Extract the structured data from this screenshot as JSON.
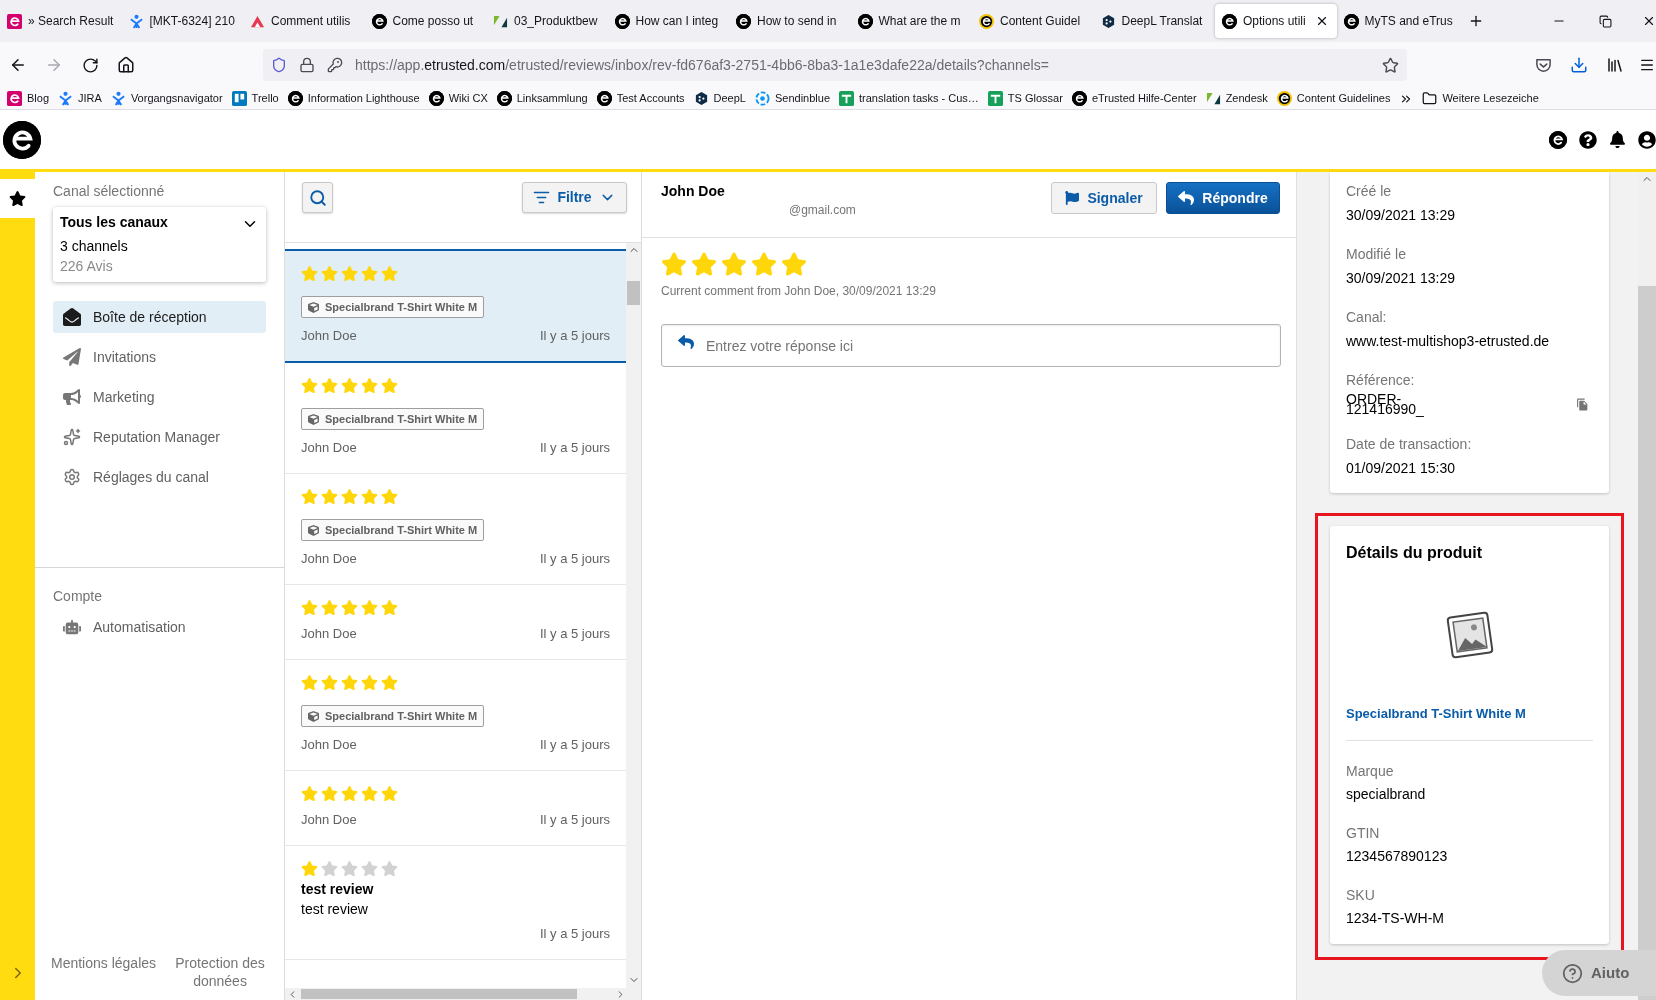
{
  "browser": {
    "tabs": [
      {
        "title": "» Search Result",
        "selected": false
      },
      {
        "title": "[MKT-6324] 210",
        "selected": false
      },
      {
        "title": "Comment utilis",
        "selected": false
      },
      {
        "title": "Come posso ut",
        "selected": false
      },
      {
        "title": "03_Produktbew",
        "selected": false
      },
      {
        "title": "How can I integ",
        "selected": false
      },
      {
        "title": "How to send in",
        "selected": false
      },
      {
        "title": "What are the m",
        "selected": false
      },
      {
        "title": "Content Guidel",
        "selected": false
      },
      {
        "title": "DeepL Translat",
        "selected": false
      },
      {
        "title": "Options utili",
        "selected": true
      },
      {
        "title": "MyTS and eTrus",
        "selected": false
      }
    ],
    "address": {
      "scheme": "https://app.",
      "domain": "etrusted.com",
      "path": "/etrusted/reviews/inbox/rev-fd676af3-2751-4bb6-8ba3-1a1e3dafe22a/details?channels="
    },
    "bookmarks": [
      "Blog",
      "JIRA",
      "Vorgangsnavigator",
      "Trello",
      "Information Lighthouse",
      "Wiki CX",
      "Linksammlung",
      "Test Accounts",
      "DeepL",
      "Sendinblue",
      "translation tasks - Cus…",
      "TS Glossar",
      "eTrusted Hilfe-Center",
      "Zendesk",
      "Content Guidelines"
    ],
    "other_bookmarks": "Weitere Lesezeiche"
  },
  "sidebar": {
    "channel_label": "Canal sélectionné",
    "channel_picker": {
      "title": "Tous les canaux",
      "subtitle": "3 channels",
      "count": "226 Avis"
    },
    "nav": [
      {
        "label": "Boîte de réception",
        "selected": true
      },
      {
        "label": "Invitations",
        "selected": false
      },
      {
        "label": "Marketing",
        "selected": false
      },
      {
        "label": "Reputation Manager",
        "selected": false
      },
      {
        "label": "Réglages du canal",
        "selected": false
      }
    ],
    "account_label": "Compte",
    "account_nav": [
      {
        "label": "Automatisation",
        "selected": false
      }
    ],
    "footer_links": [
      "Mentions légales",
      "Protection des données"
    ]
  },
  "reviews": {
    "filter_button": "Filtre",
    "items": [
      {
        "stars": 5,
        "product": "Specialbrand T-Shirt White M",
        "author": "John Doe",
        "time": "Il y a 5 jours",
        "selected": true
      },
      {
        "stars": 5,
        "product": "Specialbrand T-Shirt White M",
        "author": "John Doe",
        "time": "Il y a 5 jours",
        "selected": false
      },
      {
        "stars": 5,
        "product": "Specialbrand T-Shirt White M",
        "author": "John Doe",
        "time": "Il y a 5 jours",
        "selected": false
      },
      {
        "stars": 5,
        "author": "John Doe",
        "time": "Il y a 5 jours",
        "selected": false
      },
      {
        "stars": 5,
        "product": "Specialbrand T-Shirt White M",
        "author": "John Doe",
        "time": "Il y a 5 jours",
        "selected": false
      },
      {
        "stars": 5,
        "author": "John Doe",
        "time": "Il y a 5 jours",
        "selected": false
      },
      {
        "stars": 1,
        "title": "test review",
        "text": "test review",
        "time": "Il y a 5 jours",
        "selected": false
      }
    ]
  },
  "detail": {
    "author": "John Doe",
    "email": "@gmail.com",
    "report_button": "Signaler",
    "reply_button": "Répondre",
    "stars": 5,
    "comment_meta": "Current comment from John Doe, 30/09/2021 13:29",
    "reply_field": {
      "placeholder": "Entrez votre réponse ici"
    }
  },
  "info_card": {
    "fields": [
      {
        "label": "Créé le",
        "value": "30/09/2021 13:29",
        "copyable": false
      },
      {
        "label": "Modifié le",
        "value": "30/09/2021 13:29",
        "copyable": false
      },
      {
        "label": "Canal:",
        "value": "www.test-multishop3-etrusted.de",
        "copyable": false
      },
      {
        "label": "Référence:",
        "value": "ORDER-\n121416990_",
        "copyable": true
      },
      {
        "label": "Date de transaction:",
        "value": "01/09/2021 15:30",
        "copyable": false
      }
    ]
  },
  "product_card": {
    "title": "Détails du produit",
    "name": "Specialbrand T-Shirt White M",
    "highlighted": true,
    "fields": [
      {
        "label": "Marque",
        "value": "specialbrand"
      },
      {
        "label": "GTIN",
        "value": "1234567890123"
      },
      {
        "label": "SKU",
        "value": "1234-TS-WH-M"
      }
    ]
  },
  "help_button": "Aiuto"
}
